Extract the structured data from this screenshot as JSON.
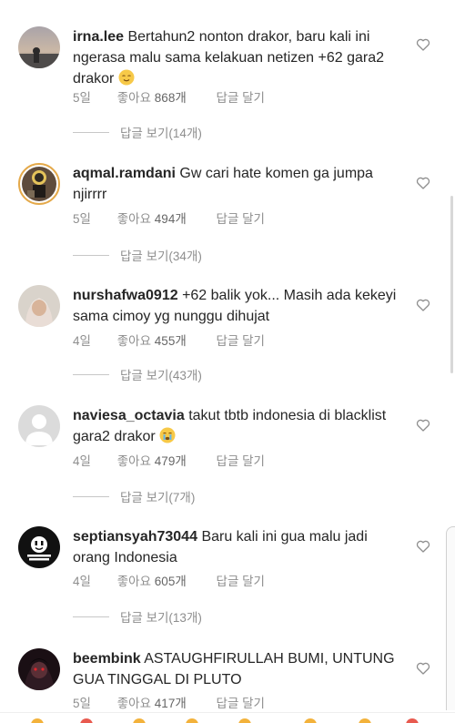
{
  "comments": [
    {
      "username": "irna.lee",
      "text": "Bertahun2 nonton drakor, baru kali ini ngerasa malu sama kelakuan netizen +62 gara2 drakor",
      "emoji": "relieved-face",
      "time": "5일",
      "likes_label": "좋아요",
      "likes_count": "868개",
      "reply_label": "답글 달기",
      "view_replies": "답글 보기(14개)"
    },
    {
      "username": "aqmal.ramdani",
      "text": "Gw cari hate komen ga jumpa njirrrr",
      "emoji": "",
      "time": "5일",
      "likes_label": "좋아요",
      "likes_count": "494개",
      "reply_label": "답글 달기",
      "view_replies": "답글 보기(34개)"
    },
    {
      "username": "nurshafwa0912",
      "text": "+62 balik yok... Masih ada kekeyi sama cimoy yg nunggu dihujat",
      "emoji": "",
      "time": "4일",
      "likes_label": "좋아요",
      "likes_count": "455개",
      "reply_label": "답글 달기",
      "view_replies": "답글 보기(43개)"
    },
    {
      "username": "naviesa_octavia",
      "text": "takut tbtb indonesia di blacklist gara2 drakor",
      "emoji": "crying-face",
      "time": "4일",
      "likes_label": "좋아요",
      "likes_count": "479개",
      "reply_label": "답글 달기",
      "view_replies": "답글 보기(7개)"
    },
    {
      "username": "septiansyah73044",
      "text": "Baru kali ini gua malu jadi orang Indonesia",
      "emoji": "",
      "time": "4일",
      "likes_label": "좋아요",
      "likes_count": "605개",
      "reply_label": "답글 달기",
      "view_replies": "답글 보기(13개)"
    },
    {
      "username": "beembink",
      "text": "ASTAUGHFIRULLAH BUMI, UNTUNG GUA TINGGAL DI PLUTO",
      "emoji": "",
      "time": "5일",
      "likes_label": "좋아요",
      "likes_count": "417개",
      "reply_label": "답글 달기",
      "view_replies": ""
    }
  ],
  "colors": {
    "text": "#262626",
    "meta": "#8e8e8e",
    "divider": "#c7c7c7",
    "story_ring": "#e4a94a"
  },
  "icons": {
    "like": "heart-outline-icon",
    "relieved": "relieved-face-emoji",
    "crying": "crying-face-emoji"
  }
}
